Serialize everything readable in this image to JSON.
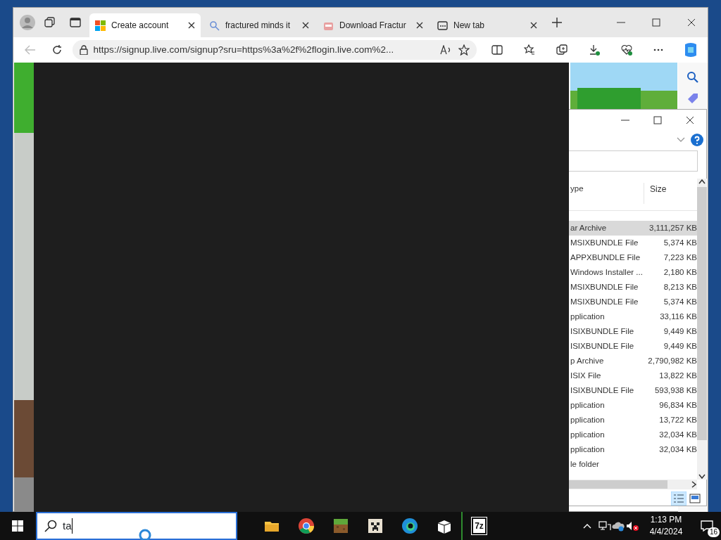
{
  "browser": {
    "tabs": [
      {
        "label": "Create account",
        "selected": true
      },
      {
        "label": "fractured minds it",
        "selected": false
      },
      {
        "label": "Download Fractur",
        "selected": false
      },
      {
        "label": "New tab",
        "selected": false
      }
    ],
    "address": "https://signup.live.com/signup?sru=https%3a%2f%2flogin.live.com%2..."
  },
  "explorer": {
    "columns": [
      "ype",
      "Size"
    ],
    "rows": [
      {
        "type": "ar Archive",
        "size": "3,111,257 KB",
        "selected": true
      },
      {
        "type": "MSIXBUNDLE File",
        "size": "5,374 KB",
        "selected": false
      },
      {
        "type": "APPXBUNDLE File",
        "size": "7,223 KB",
        "selected": false
      },
      {
        "type": "Windows Installer ...",
        "size": "2,180 KB",
        "selected": false
      },
      {
        "type": "MSIXBUNDLE File",
        "size": "8,213 KB",
        "selected": false
      },
      {
        "type": "MSIXBUNDLE File",
        "size": "5,374 KB",
        "selected": false
      },
      {
        "type": "pplication",
        "size": "33,116 KB",
        "selected": false
      },
      {
        "type": "ISIXBUNDLE File",
        "size": "9,449 KB",
        "selected": false
      },
      {
        "type": "ISIXBUNDLE File",
        "size": "9,449 KB",
        "selected": false
      },
      {
        "type": "p Archive",
        "size": "2,790,982 KB",
        "selected": false
      },
      {
        "type": "ISIX File",
        "size": "13,822 KB",
        "selected": false
      },
      {
        "type": "ISIXBUNDLE File",
        "size": "593,938 KB",
        "selected": false
      },
      {
        "type": "pplication",
        "size": "96,834 KB",
        "selected": false
      },
      {
        "type": "pplication",
        "size": "13,722 KB",
        "selected": false
      },
      {
        "type": "pplication",
        "size": "32,034 KB",
        "selected": false
      },
      {
        "type": "pplication",
        "size": "32,034 KB",
        "selected": false
      },
      {
        "type": "le folder",
        "selected": false
      }
    ]
  },
  "taskbar": {
    "search": {
      "value": "ta"
    },
    "apps": [
      {
        "kind": "folder"
      },
      {
        "kind": "chrome"
      },
      {
        "kind": "grass"
      },
      {
        "kind": "creeper"
      },
      {
        "kind": "edge"
      },
      {
        "kind": "box"
      },
      {
        "kind": "sevenzip",
        "label": "7z"
      }
    ],
    "clock": {
      "time": "1:13 PM",
      "date": "4/4/2024"
    },
    "notifications": "16"
  }
}
